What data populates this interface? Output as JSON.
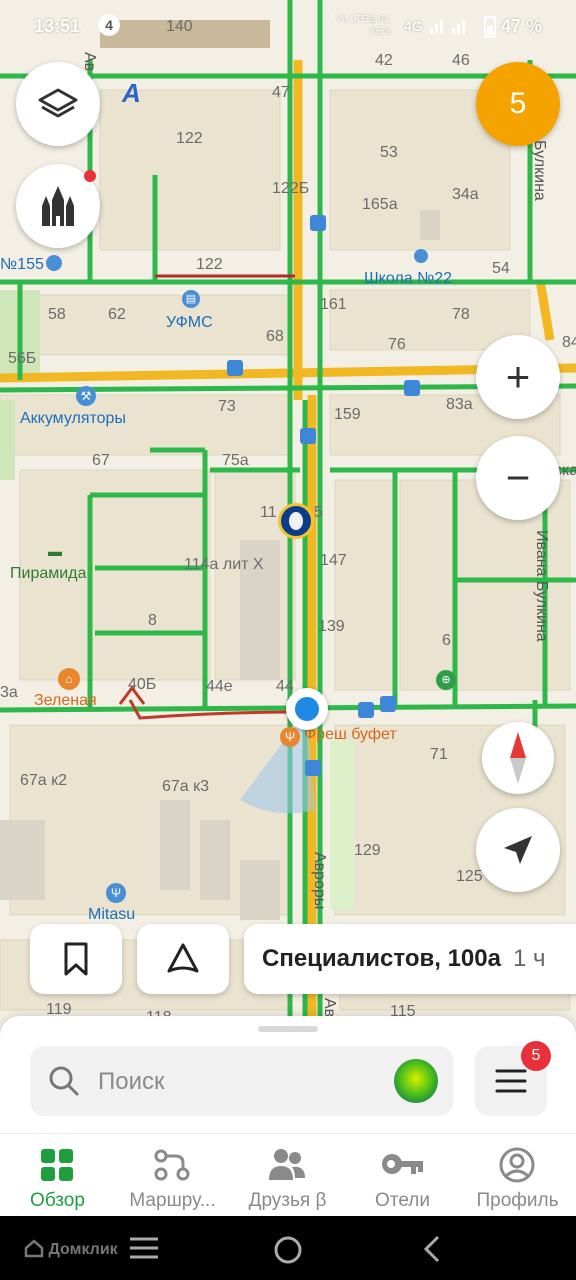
{
  "status_bar": {
    "time": "13:51",
    "notification_count": "4",
    "network": "Vo LTE1",
    "speed_value": "1,61",
    "speed_unit": "КБ/s",
    "net_type": "4G",
    "battery": "47 %"
  },
  "map": {
    "building_numbers": [
      "140",
      "42",
      "46",
      "47",
      "122",
      "53",
      "122Б",
      "165а",
      "34а",
      "122",
      "54",
      "58",
      "62",
      "161",
      "78",
      "68",
      "76",
      "84",
      "56Б",
      "73",
      "159",
      "83а",
      "67",
      "75а",
      "11",
      "5",
      "147",
      "114а лит Х",
      "139",
      "8",
      "6",
      "40Б",
      "44е",
      "44",
      "3а",
      "67а к2",
      "67а к3",
      "71",
      "129",
      "125",
      "119",
      "118",
      "115"
    ],
    "poi": {
      "school": "Школа №22",
      "ufms": "УФМС",
      "accumulators": "Аккумуляторы",
      "pyramid": "Пирамида",
      "zelenaya": "Зеленая",
      "fresh_buffet": "Фреш буфет",
      "mitasu": "Mitasu",
      "num155": "№155"
    },
    "streets": {
      "avrory": "Авроры",
      "bulkina_top": "Булкина",
      "ivana_bulkina": "Ивана Булкина",
      "ska": "ска",
      "ava": "Ав",
      "av_bottom": "Ав"
    },
    "zoom_in_label": "+",
    "zoom_out_label": "−",
    "notification_circle": "5"
  },
  "address_pill": {
    "text": "Специалистов, 100а",
    "extra": "1 ч"
  },
  "search": {
    "placeholder": "Поиск"
  },
  "menu_badge": "5",
  "tabs": [
    {
      "label": "Обзор",
      "icon": "grid-icon",
      "active": true
    },
    {
      "label": "Маршру...",
      "icon": "route-icon",
      "active": false
    },
    {
      "label": "Друзья β",
      "icon": "friends-icon",
      "active": false
    },
    {
      "label": "Отели",
      "icon": "key-icon",
      "active": false
    },
    {
      "label": "Профиль",
      "icon": "profile-icon",
      "active": false
    }
  ],
  "nav_bar": {
    "brand": "Домклик"
  },
  "colors": {
    "accent_green": "#1e9e3e",
    "traffic_green": "#2fb84a",
    "road_yellow": "#f2b824",
    "badge_red": "#e8313a",
    "orange_circle": "#f5a300",
    "location_blue": "#1e88e5"
  }
}
